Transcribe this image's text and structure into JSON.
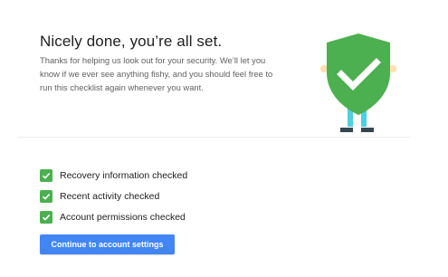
{
  "header": {
    "title": "Nicely done, you’re all set.",
    "description": "Thanks for helping us look out for your security. We’ll let you know if we ever see anything fishy, and you should feel free to run this checklist again whenever you want."
  },
  "checklist": {
    "items": [
      {
        "label": "Recovery information checked",
        "checked": true
      },
      {
        "label": "Recent activity checked",
        "checked": true
      },
      {
        "label": "Account permissions checked",
        "checked": true
      }
    ],
    "check_color": "#4caf50"
  },
  "actions": {
    "continue_label": "Continue to account settings",
    "button_color": "#4285f4"
  },
  "illustration": {
    "icon": "shield-check-icon",
    "shield_color": "#4caf50",
    "shield_shadow_color": "#388e3c",
    "legs_color": "#4dd0e1",
    "shoes_color": "#37474f",
    "hands_color": "#ffe0b2"
  }
}
